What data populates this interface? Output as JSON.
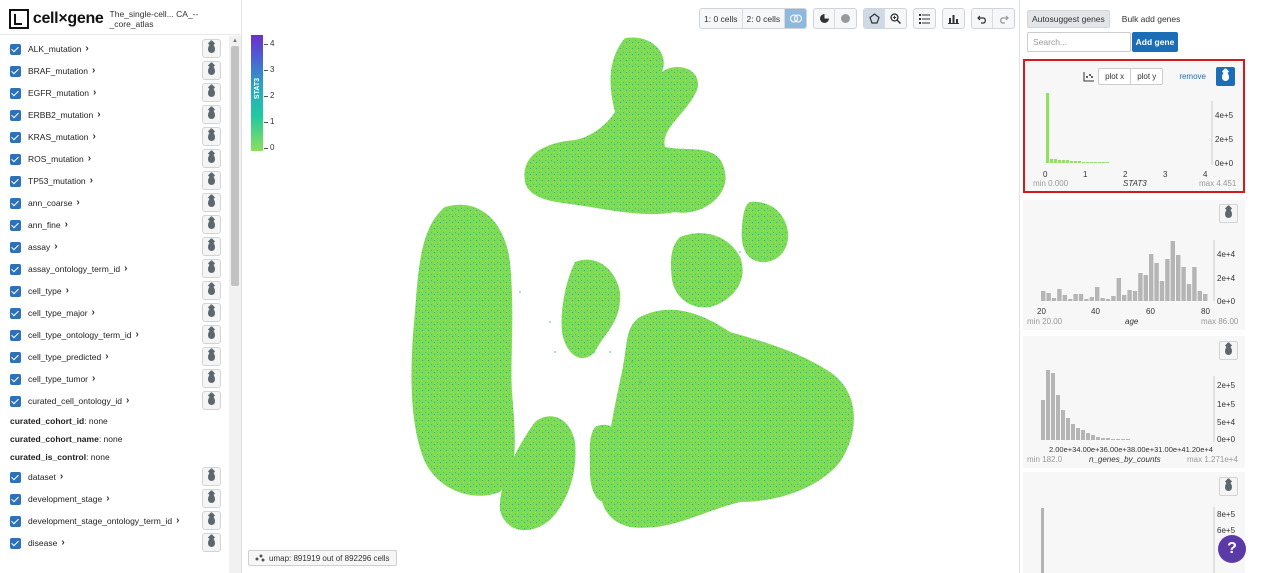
{
  "app": {
    "brand": "cell×gene",
    "dataset": "The_single-cell... CA_--_core_atlas"
  },
  "categories": [
    "ALK_mutation",
    "BRAF_mutation",
    "EGFR_mutation",
    "ERBB2_mutation",
    "KRAS_mutation",
    "ROS_mutation",
    "TP53_mutation",
    "ann_coarse",
    "ann_fine",
    "assay",
    "assay_ontology_term_id",
    "cell_type",
    "cell_type_major",
    "cell_type_ontology_term_id",
    "cell_type_predicted",
    "cell_type_tumor",
    "curated_cell_ontology_id"
  ],
  "metadata": [
    {
      "key": "curated_cohort_id",
      "value": ": none"
    },
    {
      "key": "curated_cohort_name",
      "value": ": none"
    },
    {
      "key": "curated_is_control",
      "value": ": none"
    }
  ],
  "categories2": [
    "dataset",
    "development_stage",
    "development_stage_ontology_term_id",
    "disease"
  ],
  "legend": {
    "gene": "STAT3",
    "ticks": [
      "4",
      "3",
      "2",
      "1",
      "0"
    ]
  },
  "toolbar": {
    "subset1": "1: 0 cells",
    "subset2": "2: 0 cells"
  },
  "status": {
    "text": "umap: 891919 out of 892296 cells"
  },
  "genes": {
    "tab_autosuggest": "Autosuggest genes",
    "tab_bulk": "Bulk add genes",
    "search_placeholder": "Search...",
    "add_button": "Add gene"
  },
  "histograms": [
    {
      "plot_x": "plot x",
      "plot_y": "plot y",
      "remove": "remove",
      "xticks": [
        "0",
        "1",
        "2",
        "3",
        "4"
      ],
      "yticks": [
        "4e+5",
        "2e+5",
        "0e+0"
      ],
      "min": "min 0.000",
      "name": "STAT3",
      "max": "max 4.451"
    },
    {
      "xticks": [
        "20",
        "40",
        "60",
        "80"
      ],
      "yticks": [
        "4e+4",
        "2e+4",
        "0e+0"
      ],
      "min": "min 20.00",
      "name": "age",
      "max": "max 86.00"
    },
    {
      "xticks": "2.00e+34.00e+36.00e+38.00e+31.00e+41.20e+4",
      "yticks": [
        "2e+5",
        "1e+5",
        "5e+4",
        "0e+0"
      ],
      "min": "min 182.0",
      "name": "n_genes_by_counts",
      "max": "max 1.271e+4"
    },
    {
      "yticks": [
        "8e+5",
        "6e+5"
      ]
    }
  ],
  "help": "?",
  "colors": {
    "accent": "#1b6eb5",
    "checkbox": "#2d72b7",
    "highlight": "#d41a1a",
    "hist_stat3": "#8fe05a",
    "hist_gray": "#b5b5b5"
  },
  "icons": [
    "drop-icon",
    "checkbox-icon",
    "chevron-right-icon",
    "lasso-icon",
    "zoom-icon",
    "undo-icon",
    "redo-icon",
    "info-icon",
    "list-icon",
    "bar-chart-icon",
    "scatter-icon",
    "pie-icon",
    "circle-icon"
  ]
}
